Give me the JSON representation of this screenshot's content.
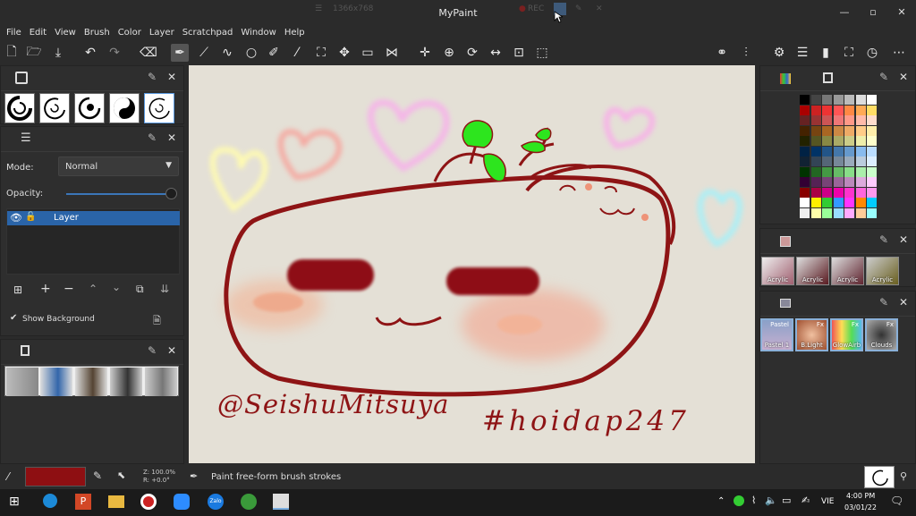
{
  "window": {
    "title": "MyPaint",
    "recorder_resolution": "1366x768",
    "recorder_label": "REC",
    "controls": {
      "minimize": "—",
      "maximize": "▫",
      "close": "✕"
    }
  },
  "menu": [
    "File",
    "Edit",
    "View",
    "Brush",
    "Color",
    "Layer",
    "Scratchpad",
    "Window",
    "Help"
  ],
  "layers_panel": {
    "mode_label": "Mode:",
    "mode_value": "Normal",
    "opacity_label": "Opacity:",
    "opacity_value": 1.0,
    "layer_name": "Layer",
    "show_background_label": "Show Background"
  },
  "canvas": {
    "signature": "@SeishuMitsuya",
    "hashtag": "#hoidap247"
  },
  "brush_presets_1": [
    "Acrylic",
    "Acrylic",
    "Acrylic",
    "Acrylic"
  ],
  "brush_presets_2": [
    "Pastel 1",
    "B.Light",
    "GlowAirb",
    "Clouds"
  ],
  "brush_presets_2_badges": [
    "Pastel",
    "Fx",
    "Fx",
    "Fx"
  ],
  "status": {
    "zoom": "Z: 100.0%",
    "rotation": "R: +0.0°",
    "message": "Paint free-form brush strokes",
    "color": "#8e0f12"
  },
  "taskbar": {
    "language": "VIE",
    "time": "4:00 PM",
    "date": "03/01/22"
  },
  "colors": {
    "selection": "#2a64a8",
    "accent_red": "#8e0f12"
  }
}
